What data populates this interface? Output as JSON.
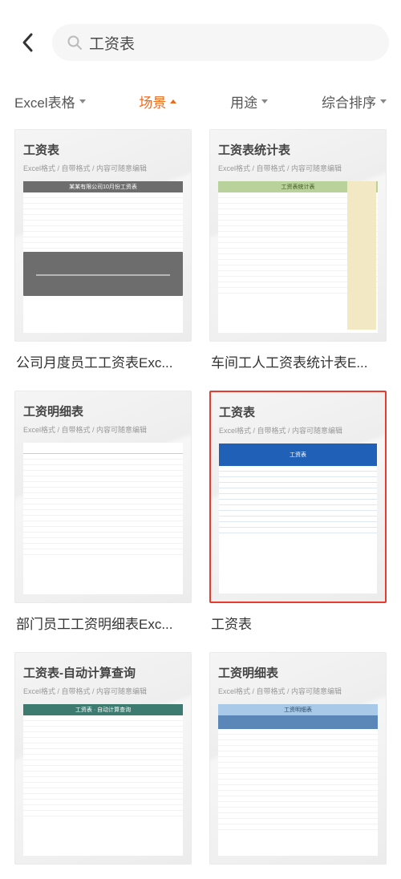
{
  "search": {
    "query": "工资表"
  },
  "filters": {
    "format": "Excel表格",
    "scene": "场景",
    "use": "用途",
    "sort": "综合排序",
    "active": "scene"
  },
  "thumb_sub": "Excel格式 / 自带格式 / 内容可随意编辑",
  "templates": [
    {
      "thumb_title": "工资表",
      "banner": "某某有限公司10月份工资表",
      "style": "gray",
      "caption": "公司月度员工工资表Exc...",
      "highlight": false
    },
    {
      "thumb_title": "工资表统计表",
      "banner": "工资表统计表",
      "style": "green",
      "caption": "车间工人工资表统计表E...",
      "highlight": false
    },
    {
      "thumb_title": "工资明细表",
      "banner": "",
      "style": "plain",
      "caption": "部门员工工资明细表Exc...",
      "highlight": false
    },
    {
      "thumb_title": "工资表",
      "banner": "工资表",
      "style": "blue",
      "caption": "工资表",
      "highlight": true
    },
    {
      "thumb_title": "工资表-自动计算查询",
      "banner": "工资表 · 自动计算查询",
      "style": "teal",
      "caption": "",
      "highlight": false
    },
    {
      "thumb_title": "工资明细表",
      "banner": "工资明细表",
      "style": "sky",
      "caption": "",
      "highlight": false
    }
  ]
}
